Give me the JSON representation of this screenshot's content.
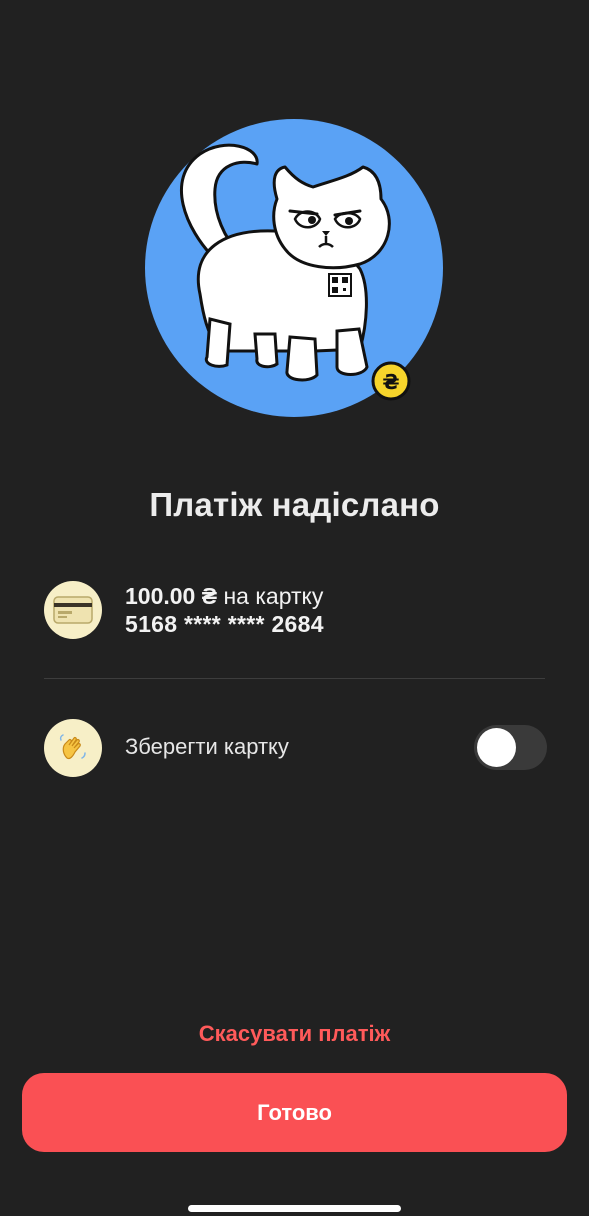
{
  "title": "Платіж надіслано",
  "payment": {
    "amount": "100.00 ₴",
    "to_card_text": " на картку",
    "card_number": "5168 **** **** 2684",
    "icon": "card-icon"
  },
  "save_card": {
    "label": "Зберегти картку",
    "icon": "waving-hand-icon",
    "enabled": false
  },
  "actions": {
    "cancel_label": "Скасувати платіж",
    "done_label": "Готово"
  },
  "colors": {
    "background": "#212121",
    "accent": "#fa5054",
    "cancel_text": "#ff5a5a",
    "illustration_circle": "#5aa2f5",
    "coin": "#f6d42b",
    "avatar_bg": "#f7efc7"
  },
  "illustration": {
    "badge_symbol": "₴"
  }
}
